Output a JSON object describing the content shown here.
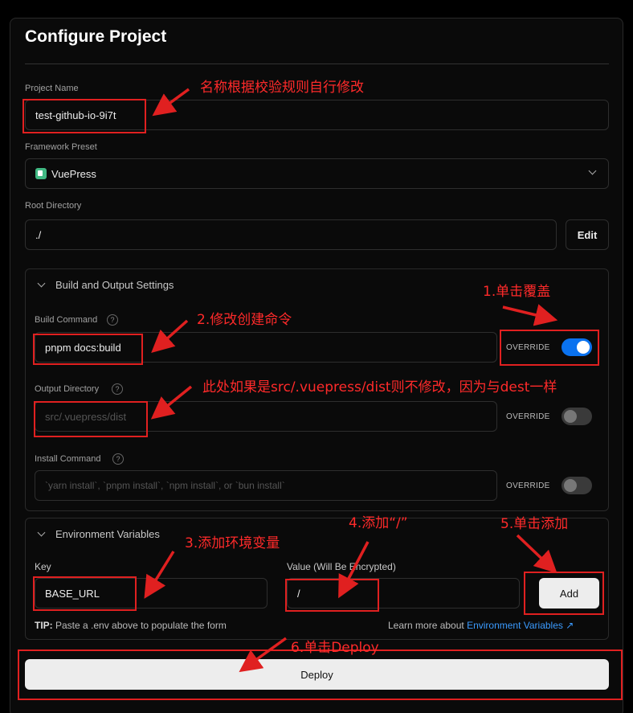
{
  "page": {
    "title": "Configure Project"
  },
  "project_name": {
    "label": "Project Name",
    "value": "test-github-io-9i7t"
  },
  "framework": {
    "label": "Framework Preset",
    "value": "VuePress",
    "icon": "vuepress-logo-icon"
  },
  "root_dir": {
    "label": "Root Directory",
    "value": "./",
    "edit_label": "Edit"
  },
  "build": {
    "title": "Build and Output Settings",
    "build_command": {
      "label": "Build Command",
      "value": "pnpm docs:build",
      "override_label": "OVERRIDE",
      "override_on": true
    },
    "output_dir": {
      "label": "Output Directory",
      "placeholder": "src/.vuepress/dist",
      "override_label": "OVERRIDE",
      "override_on": false
    },
    "install_command": {
      "label": "Install Command",
      "placeholder": "`yarn install`, `pnpm install`, `npm install`, or `bun install`",
      "override_label": "OVERRIDE",
      "override_on": false
    }
  },
  "env": {
    "title": "Environment Variables",
    "key_label": "Key",
    "key_value": "BASE_URL",
    "value_label": "Value (Will Be Encrypted)",
    "value_value": "/",
    "add_label": "Add",
    "tip_bold": "TIP:",
    "tip_text": " Paste a .env above to populate the form",
    "learn_text": "Learn more about ",
    "learn_link": "Environment Variables"
  },
  "deploy_label": "Deploy",
  "annotations": {
    "a0": "名称根据校验规则自行修改",
    "a1": "1.单击覆盖",
    "a2": "2.修改创建命令",
    "a_out": "此处如果是src/.vuepress/dist则不修改，因为与dest一样",
    "a3": "3.添加环境变量",
    "a4": "4.添加“/”",
    "a5": "5.单击添加",
    "a6": "6.单击Deploy"
  },
  "colors": {
    "accent_blue": "#0a72ef",
    "annotation_red": "#e02020",
    "background": "#0a0a0a"
  }
}
